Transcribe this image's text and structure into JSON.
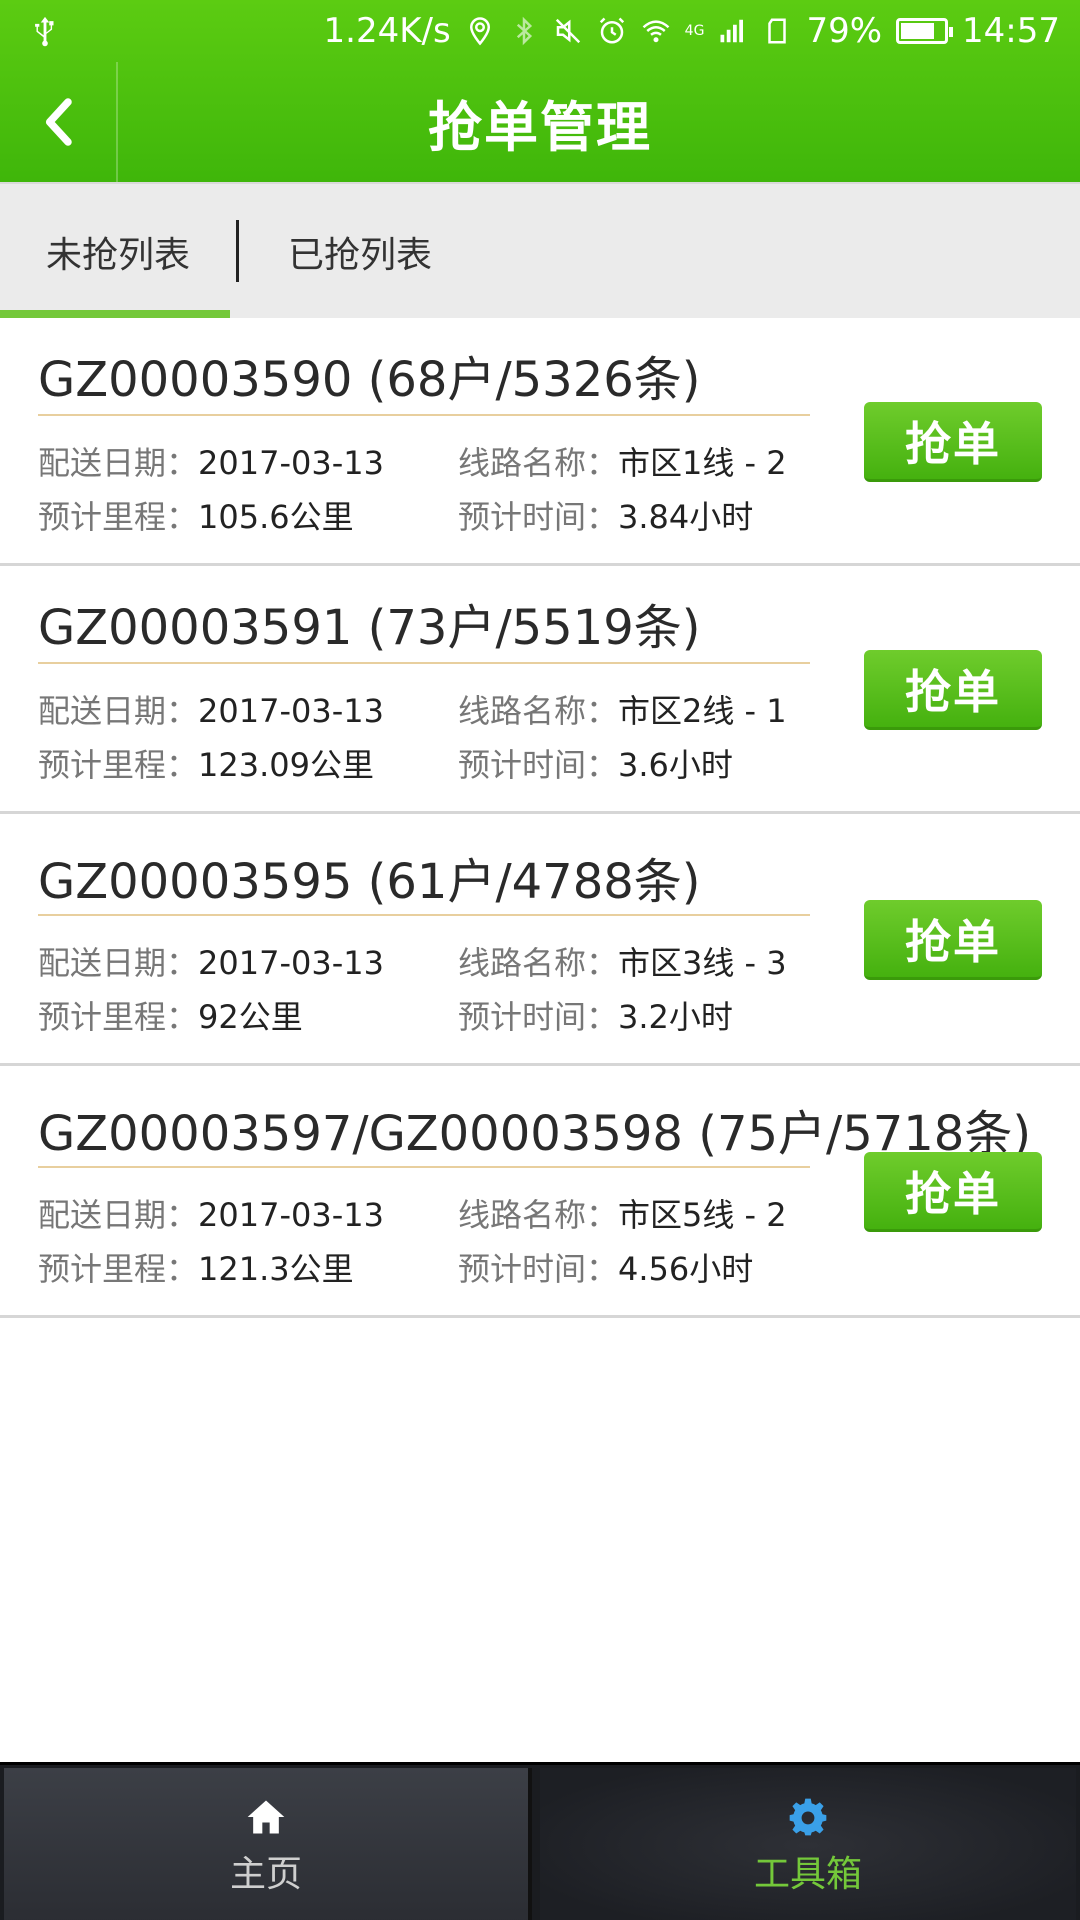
{
  "status_bar": {
    "speed": "1.24K/s",
    "network": "4G",
    "battery": "79%",
    "battery_fraction": 0.79,
    "time": "14:57"
  },
  "header": {
    "title": "抢单管理"
  },
  "tabs": [
    {
      "label": "未抢列表",
      "active": true
    },
    {
      "label": "已抢列表",
      "active": false
    }
  ],
  "orders": [
    {
      "code": "GZ00003590 (68户/5326条)",
      "date_label": "配送日期：",
      "date": "2017-03-13",
      "route_label": "线路名称：",
      "route": "市区1线 - 2",
      "distance_label": "预计里程：",
      "distance": "105.6公里",
      "time_label": "预计时间：",
      "time": "3.84小时",
      "button": "抢单"
    },
    {
      "code": "GZ00003591 (73户/5519条)",
      "date_label": "配送日期：",
      "date": "2017-03-13",
      "route_label": "线路名称：",
      "route": "市区2线 - 1",
      "distance_label": "预计里程：",
      "distance": "123.09公里",
      "time_label": "预计时间：",
      "time": "3.6小时",
      "button": "抢单"
    },
    {
      "code": "GZ00003595 (61户/4788条)",
      "date_label": "配送日期：",
      "date": "2017-03-13",
      "route_label": "线路名称：",
      "route": "市区3线 - 3",
      "distance_label": "预计里程：",
      "distance": "92公里",
      "time_label": "预计时间：",
      "time": "3.2小时",
      "button": "抢单"
    },
    {
      "code": "GZ00003597/GZ00003598 (75户/5718条)",
      "date_label": "配送日期：",
      "date": "2017-03-13",
      "route_label": "线路名称：",
      "route": "市区5线 - 2",
      "distance_label": "预计里程：",
      "distance": "121.3公里",
      "time_label": "预计时间：",
      "time": "4.56小时",
      "button": "抢单"
    }
  ],
  "bottom_nav": [
    {
      "label": "主页",
      "icon": "home-icon",
      "active": false
    },
    {
      "label": "工具箱",
      "icon": "gear-icon",
      "active": true
    }
  ],
  "colors": {
    "brand_green": "#4cbf0e",
    "accent_green": "#74c83a",
    "nav_bg": "#1a1c20"
  }
}
